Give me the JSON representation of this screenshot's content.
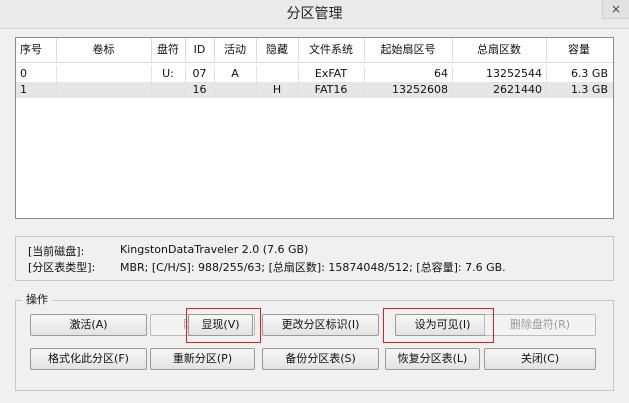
{
  "window": {
    "title": "分区管理",
    "close_label": "×"
  },
  "table": {
    "columns": [
      "序号",
      "卷标",
      "盘符",
      "ID",
      "活动",
      "隐藏",
      "文件系统",
      "起始扇区号",
      "总扇区数",
      "容量"
    ],
    "rows": [
      [
        "0",
        "",
        "U:",
        "07",
        "A",
        "",
        "ExFAT",
        "64",
        "13252544",
        "6.3 GB"
      ],
      [
        "1",
        "",
        "",
        "16",
        "",
        "H",
        "FAT16",
        "13252608",
        "2621440",
        "1.3 GB"
      ]
    ]
  },
  "info": {
    "disk_label": "[当前磁盘]:",
    "disk_value": "KingstonDataTraveler 2.0 (7.6 GB)",
    "ptype_label": "[分区表类型]:",
    "ptype_value": "MBR;     [C/H/S]: 988/255/63; [总扇区数]: 15874048/512; [总容量]: 7.6 GB."
  },
  "operations": {
    "label": "操作",
    "activate": "激活(A)",
    "hide": "隐藏(H)",
    "show": "显现(V)",
    "change_id": "更改分区标识(I)",
    "set_visible": "设为可见(I)",
    "remove_letter": "删除盘符(R)",
    "format": "格式化此分区(F)",
    "repartition": "重新分区(P)",
    "backup": "备份分区表(S)",
    "restore": "恢复分区表(L)",
    "close": "关闭(C)"
  }
}
